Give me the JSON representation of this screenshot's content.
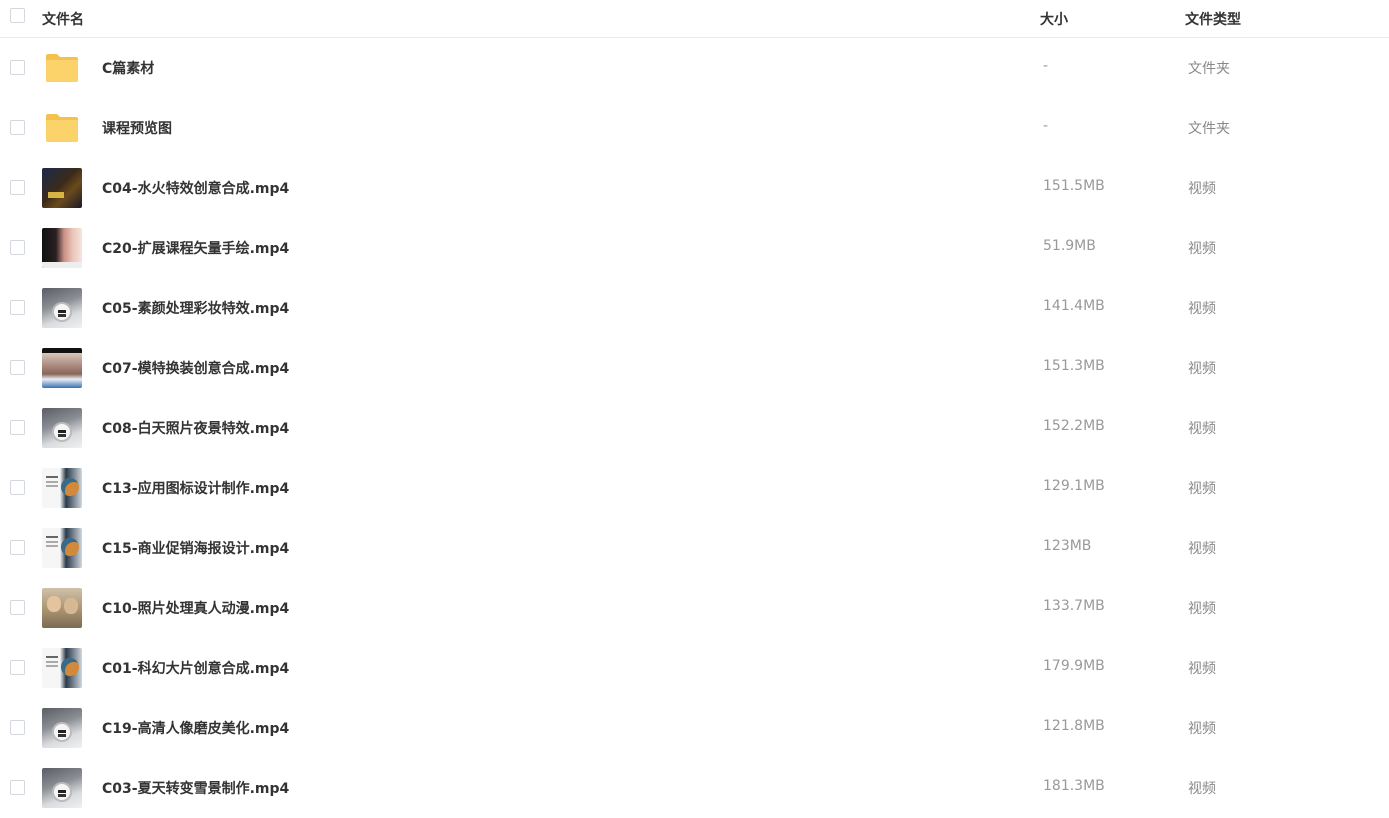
{
  "header": {
    "name": "文件名",
    "size": "大小",
    "type": "文件类型"
  },
  "files": [
    {
      "name": "C篇素材",
      "size": "-",
      "type": "文件夹",
      "icon": "folder-icon"
    },
    {
      "name": "课程预览图",
      "size": "-",
      "type": "文件夹",
      "icon": "folder-icon"
    },
    {
      "name": "C04-水火特效创意合成.mp4",
      "size": "151.5MB",
      "type": "视频",
      "icon": "video-thumbnail"
    },
    {
      "name": "C20-扩展课程矢量手绘.mp4",
      "size": "51.9MB",
      "type": "视频",
      "icon": "video-thumbnail"
    },
    {
      "name": "C05-素颜处理彩妆特效.mp4",
      "size": "141.4MB",
      "type": "视频",
      "icon": "video-thumbnail"
    },
    {
      "name": "C07-模特换装创意合成.mp4",
      "size": "151.3MB",
      "type": "视频",
      "icon": "video-thumbnail"
    },
    {
      "name": "C08-白天照片夜景特效.mp4",
      "size": "152.2MB",
      "type": "视频",
      "icon": "video-thumbnail"
    },
    {
      "name": "C13-应用图标设计制作.mp4",
      "size": "129.1MB",
      "type": "视频",
      "icon": "video-thumbnail"
    },
    {
      "name": "C15-商业促销海报设计.mp4",
      "size": "123MB",
      "type": "视频",
      "icon": "video-thumbnail"
    },
    {
      "name": "C10-照片处理真人动漫.mp4",
      "size": "133.7MB",
      "type": "视频",
      "icon": "video-thumbnail"
    },
    {
      "name": "C01-科幻大片创意合成.mp4",
      "size": "179.9MB",
      "type": "视频",
      "icon": "video-thumbnail"
    },
    {
      "name": "C19-高清人像磨皮美化.mp4",
      "size": "121.8MB",
      "type": "视频",
      "icon": "video-thumbnail"
    },
    {
      "name": "C03-夏天转变雪景制作.mp4",
      "size": "181.3MB",
      "type": "视频",
      "icon": "video-thumbnail"
    }
  ],
  "colors": {
    "folder": "#fcd36b",
    "folder_tab": "#f5c14e",
    "divider": "#e9e9ee",
    "secondary_text": "#999999"
  }
}
